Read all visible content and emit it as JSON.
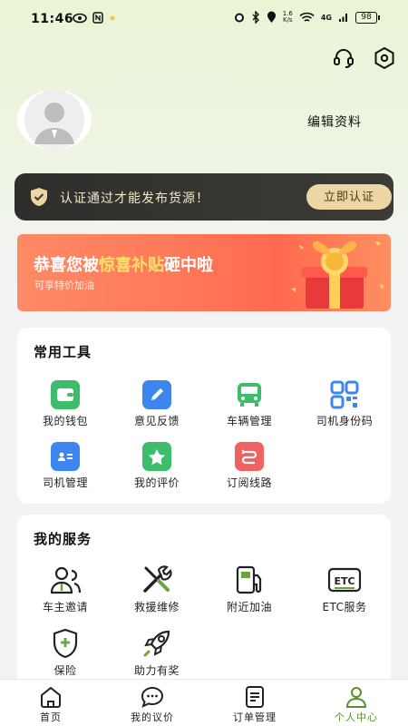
{
  "status_bar": {
    "time": "11:46",
    "speed_top": "1.6",
    "speed_unit": "K/s",
    "network": "4G",
    "battery": "98"
  },
  "profile": {
    "edit_label": "编辑资料"
  },
  "certify": {
    "text": "认证通过才能发布货源！",
    "button": "立即认证"
  },
  "promo": {
    "title_pre": "恭喜您被",
    "title_hl": "惊喜补贴",
    "title_post": "砸中啦",
    "subtitle": "可享特价加油"
  },
  "tools": {
    "title": "常用工具",
    "items": [
      {
        "label": "我的钱包",
        "icon": "wallet-icon",
        "color": "#3dbd6b"
      },
      {
        "label": "意见反馈",
        "icon": "feedback-pencil-icon",
        "color": "#3d86f0"
      },
      {
        "label": "车辆管理",
        "icon": "bus-icon",
        "color": "#3dbd6b"
      },
      {
        "label": "司机身份码",
        "icon": "qr-code-icon",
        "color": "#3d86f0"
      },
      {
        "label": "司机管理",
        "icon": "id-card-icon",
        "color": "#3d86f0"
      },
      {
        "label": "我的评价",
        "icon": "star-icon",
        "color": "#3dbd6b"
      },
      {
        "label": "订阅线路",
        "icon": "route-icon",
        "color": "#f06262"
      }
    ]
  },
  "services": {
    "title": "我的服务",
    "items": [
      {
        "label": "车主邀请",
        "icon": "owner-invite-icon"
      },
      {
        "label": "救援维修",
        "icon": "repair-tools-icon"
      },
      {
        "label": "附近加油",
        "icon": "fuel-pump-icon"
      },
      {
        "label": "ETC服务",
        "icon": "etc-icon",
        "badge": "ETC"
      },
      {
        "label": "保险",
        "icon": "insurance-shield-icon"
      },
      {
        "label": "助力有奖",
        "icon": "rocket-icon"
      }
    ]
  },
  "nav": {
    "items": [
      {
        "label": "首页",
        "icon": "home-icon"
      },
      {
        "label": "我的议价",
        "icon": "chat-bubble-icon"
      },
      {
        "label": "订单管理",
        "icon": "order-list-icon"
      },
      {
        "label": "个人中心",
        "icon": "person-icon",
        "active": true
      }
    ],
    "active_color": "#5a8f2f"
  }
}
